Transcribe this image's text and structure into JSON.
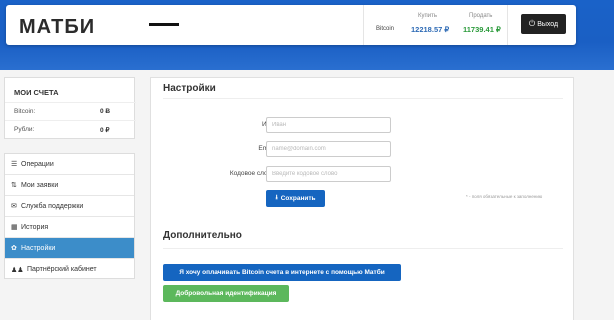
{
  "header": {
    "logo": "МАТБИ",
    "rates": {
      "buy_label": "Купить",
      "sell_label": "Продать",
      "symbol": "Bitcoin",
      "buy_value": "12218.57 ₽",
      "sell_value": "11739.41 ₽"
    },
    "logout_label": "Выход",
    "logout_icon": "logout-icon"
  },
  "accounts": {
    "title": "МОИ СЧЕТА",
    "items": [
      {
        "name": "Bitcoin:",
        "value": "0 Ƀ"
      },
      {
        "name": "Рубли:",
        "value": "0 ₽"
      }
    ]
  },
  "menu": {
    "items": [
      {
        "label": "Операции",
        "icon": "list-icon",
        "glyph": "☰"
      },
      {
        "label": "Мои заявки",
        "icon": "sort-icon",
        "glyph": "⇅"
      },
      {
        "label": "Служба поддержки",
        "icon": "envelope-icon",
        "glyph": "✉"
      },
      {
        "label": "История",
        "icon": "calendar-icon",
        "glyph": "▦"
      },
      {
        "label": "Настройки",
        "icon": "gear-icon",
        "glyph": "✿"
      },
      {
        "label": "Партнёрский кабинет",
        "icon": "users-icon",
        "glyph": "♟♟"
      }
    ],
    "active_index": 4
  },
  "settings": {
    "title": "Настройки",
    "fields": [
      {
        "label": "Имя*:",
        "placeholder": "Иван"
      },
      {
        "label": "Email*:",
        "placeholder": "name@domain.com"
      },
      {
        "label": "Кодовое слово*:",
        "placeholder": "Введите кодовое слово"
      }
    ],
    "required_note": "* - поля обязательные к заполнению",
    "save_label": "Сохранить",
    "save_icon": "save-icon"
  },
  "additional": {
    "title": "Дополнительно",
    "pay_label": "Я хочу оплачивать Bitcoin счета в интернете с помощью Матби",
    "ident_label": "Добровольная идентификация"
  },
  "colors": {
    "brand_blue": "#1a62c8",
    "primary_button": "#1565c0",
    "success_button": "#5cb85c",
    "active_menu": "#3c8dc9",
    "buy_value": "#2d6ab5",
    "sell_value": "#2a9a3a"
  }
}
